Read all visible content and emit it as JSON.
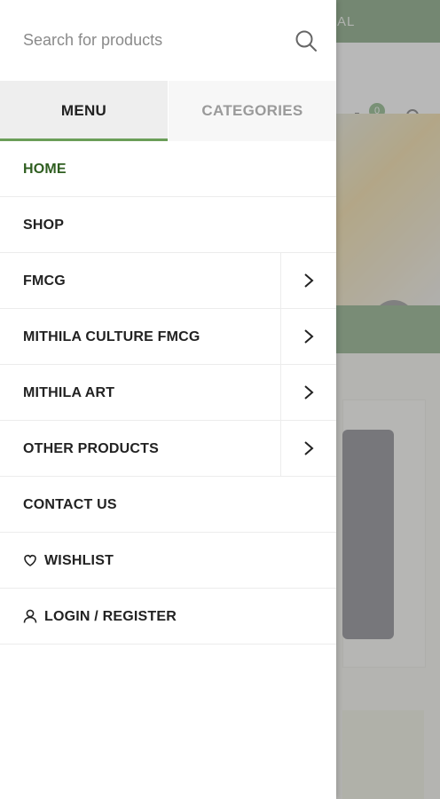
{
  "background": {
    "topbar_text": "AL",
    "cart_count": "0",
    "slider_arrow": "›"
  },
  "drawer": {
    "search": {
      "placeholder": "Search for products",
      "icon": "search-icon"
    },
    "tabs": [
      {
        "label": "MENU",
        "active": true
      },
      {
        "label": "CATEGORIES",
        "active": false
      }
    ],
    "items": [
      {
        "label": "HOME",
        "active": true,
        "has_submenu": false
      },
      {
        "label": "SHOP",
        "active": false,
        "has_submenu": false
      },
      {
        "label": "FMCG",
        "active": false,
        "has_submenu": true
      },
      {
        "label": "MITHILA CULTURE FMCG",
        "active": false,
        "has_submenu": true
      },
      {
        "label": "MITHILA ART",
        "active": false,
        "has_submenu": true
      },
      {
        "label": "OTHER PRODUCTS",
        "active": false,
        "has_submenu": true
      },
      {
        "label": "CONTACT US",
        "active": false,
        "has_submenu": false
      },
      {
        "label": "WISHLIST",
        "active": false,
        "has_submenu": false,
        "icon": "heart-icon"
      },
      {
        "label": "LOGIN / REGISTER",
        "active": false,
        "has_submenu": false,
        "icon": "user-icon"
      }
    ]
  },
  "colors": {
    "accent": "#2f5e20",
    "tab_underline": "#6a9e58",
    "topbar": "#2f6a2a"
  }
}
